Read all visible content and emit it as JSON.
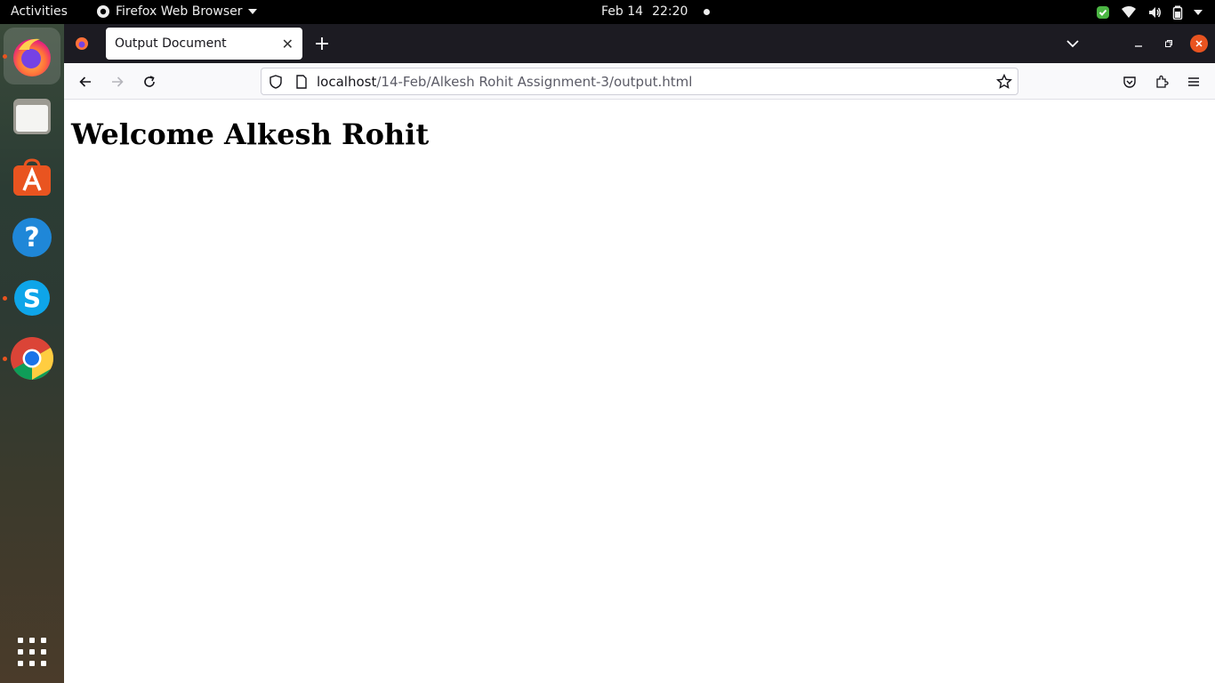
{
  "topbar": {
    "activities": "Activities",
    "app_name": "Firefox Web Browser",
    "date": "Feb 14",
    "time": "22:20"
  },
  "dock": {
    "items": [
      "firefox-icon",
      "files-icon",
      "app-center-icon",
      "help-icon",
      "skype-icon",
      "chrome-icon"
    ],
    "apps_grid": "show-apps-icon"
  },
  "browser": {
    "tab_title": "Output Document",
    "url_host": "localhost",
    "url_path": "/14-Feb/Alkesh Rohit Assignment-3/output.html"
  },
  "page": {
    "heading": "Welcome Alkesh Rohit"
  },
  "colors": {
    "firefox_orange": "#e9541f",
    "tabbar_bg": "#1c1b22",
    "close_red": "#e95420"
  }
}
